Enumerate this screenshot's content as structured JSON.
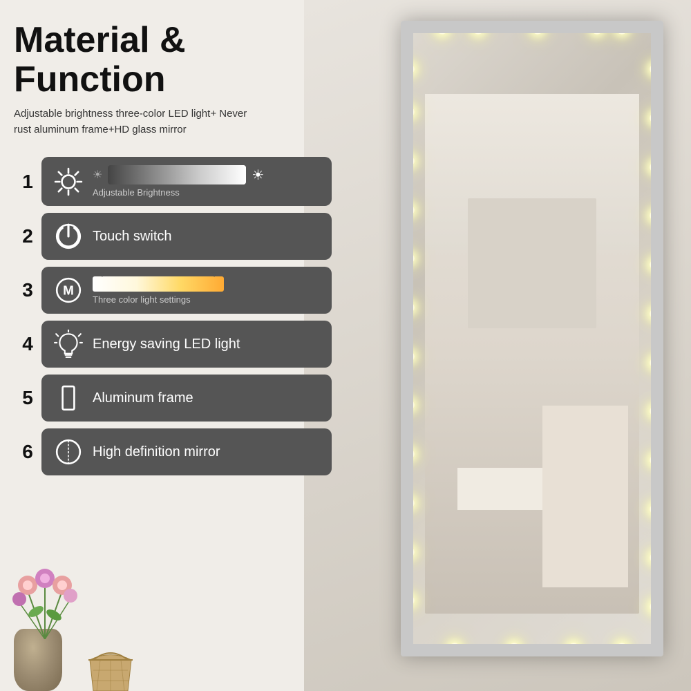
{
  "page": {
    "title": "Material & Function",
    "subtitle": "Adjustable brightness three-color LED light+ Never rust aluminum frame+HD glass mirror"
  },
  "features": [
    {
      "number": "1",
      "label": "Adjustable Brightness",
      "icon": "brightness-icon",
      "type": "brightness-bar"
    },
    {
      "number": "2",
      "label": "Touch switch",
      "icon": "power-icon",
      "type": "text"
    },
    {
      "number": "3",
      "label": "Three color light settings",
      "icon": "mode-icon",
      "type": "color-bar"
    },
    {
      "number": "4",
      "label": "Energy saving LED light",
      "icon": "bulb-icon",
      "type": "text"
    },
    {
      "number": "5",
      "label": "Aluminum frame",
      "icon": "frame-icon",
      "type": "text"
    },
    {
      "number": "6",
      "label": "High definition mirror",
      "icon": "mirror-icon",
      "type": "text"
    }
  ]
}
